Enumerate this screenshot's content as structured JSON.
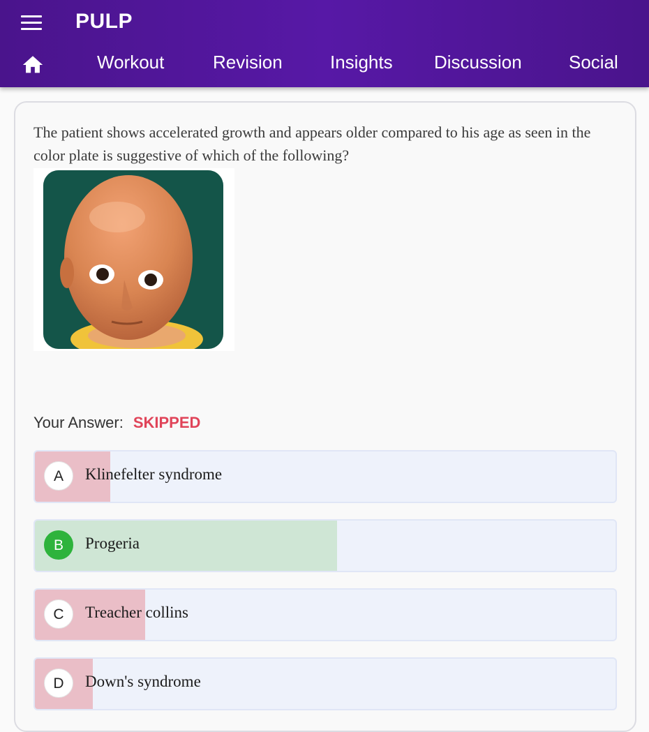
{
  "app": {
    "title": "PULP"
  },
  "icons": {
    "menu": "hamburger-menu-icon",
    "home": "home-icon"
  },
  "nav": {
    "items": [
      {
        "label": "Workout"
      },
      {
        "label": "Revision"
      },
      {
        "label": "Insights"
      },
      {
        "label": "Discussion"
      },
      {
        "label": "Social"
      }
    ]
  },
  "question": {
    "text": "The patient shows accelerated growth and appears older compared to his age as seen in the color plate is suggestive of which of the following?"
  },
  "answer": {
    "label": "Your Answer:",
    "value": "SKIPPED"
  },
  "options": [
    {
      "letter": "A",
      "text": "Klinefelter syndrome",
      "correct": false,
      "fill_fraction": 0.13
    },
    {
      "letter": "B",
      "text": "Progeria",
      "correct": true,
      "fill_fraction": 0.52
    },
    {
      "letter": "C",
      "text": "Treacher collins",
      "correct": false,
      "fill_fraction": 0.19
    },
    {
      "letter": "D",
      "text": "Down's syndrome",
      "correct": false,
      "fill_fraction": 0.1
    }
  ],
  "colors": {
    "header": "#4a148c",
    "skipped": "#e04459",
    "correct_fill": "#cfe6d5",
    "wrong_fill": "#eabec7",
    "correct_badge": "#2eb33c",
    "option_bg": "#eef2fb"
  }
}
